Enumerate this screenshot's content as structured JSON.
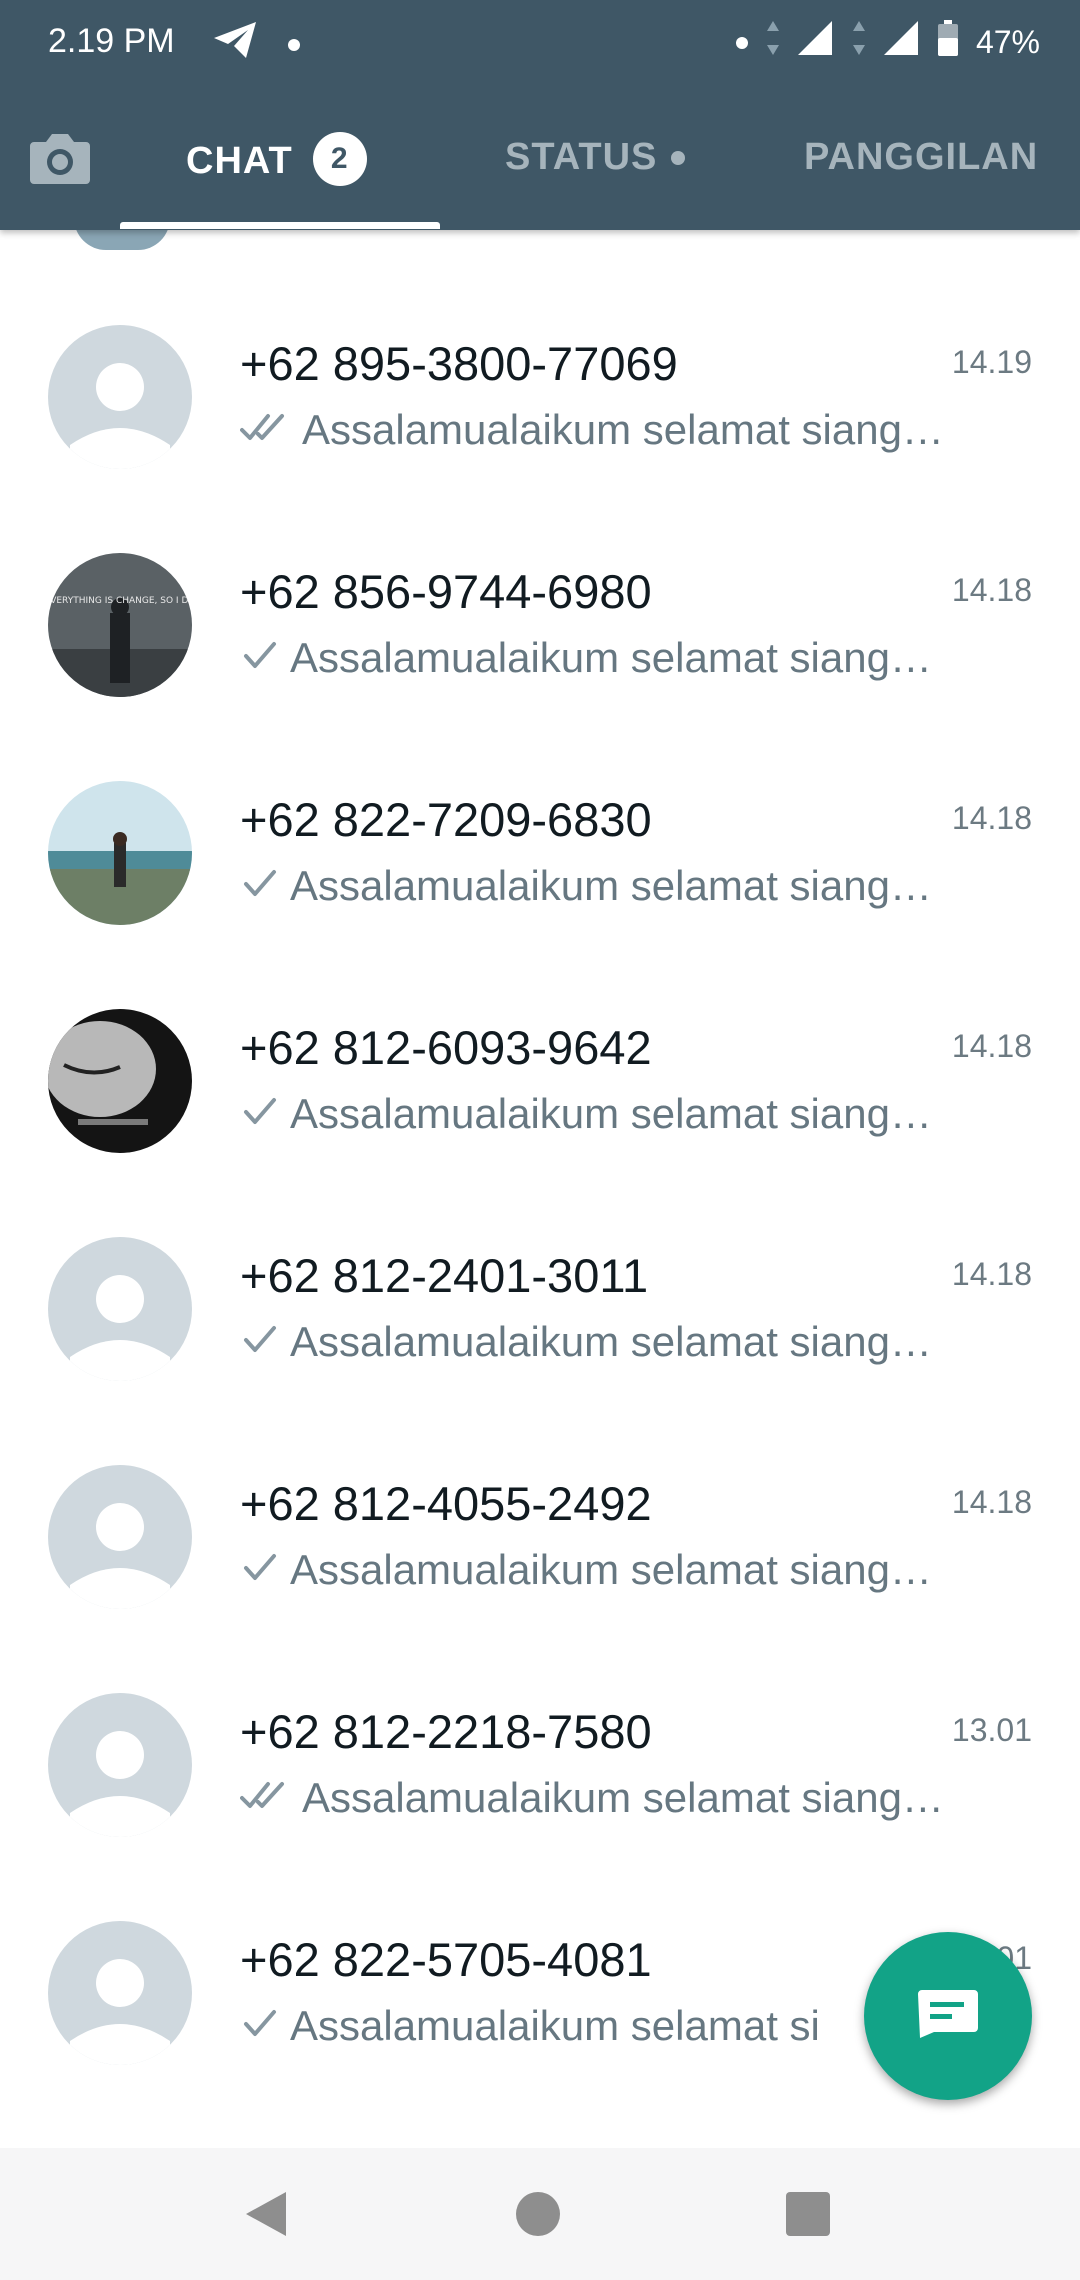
{
  "status_bar": {
    "time": "2.19 PM",
    "battery": "47%",
    "icons": [
      "telegram-icon",
      "dot-icon",
      "dot-icon",
      "data-arrows-icon",
      "signal-icon",
      "signal-icon",
      "battery-icon"
    ]
  },
  "tabs": {
    "camera_icon": "camera-icon",
    "chat": {
      "label": "CHAT",
      "badge": "2"
    },
    "status": {
      "label": "STATUS"
    },
    "calls": {
      "label": "PANGGILAN"
    },
    "active": "chat"
  },
  "chats": [
    {
      "name": "+62 895-3800-77069",
      "time": "14.19",
      "preview": "Assalamualaikum selamat siang…",
      "tick": "double",
      "avatar": "default"
    },
    {
      "name": "+62 856-9744-6980",
      "time": "14.18",
      "preview": "Assalamualaikum selamat siang…",
      "tick": "single",
      "avatar": "photo-dark",
      "avatar_text": "EVERYTHING IS CHANGE, SO I DO"
    },
    {
      "name": "+62 822-7209-6830",
      "time": "14.18",
      "preview": "Assalamualaikum selamat siang…",
      "tick": "single",
      "avatar": "photo-landscape"
    },
    {
      "name": "+62 812-6093-9642",
      "time": "14.18",
      "preview": "Assalamualaikum selamat siang…",
      "tick": "single",
      "avatar": "photo-bw"
    },
    {
      "name": "+62 812-2401-3011",
      "time": "14.18",
      "preview": "Assalamualaikum selamat siang…",
      "tick": "single",
      "avatar": "default"
    },
    {
      "name": "+62 812-4055-2492",
      "time": "14.18",
      "preview": "Assalamualaikum selamat siang…",
      "tick": "single",
      "avatar": "default"
    },
    {
      "name": "+62 812-2218-7580",
      "time": "13.01",
      "preview": "Assalamualaikum selamat siang…",
      "tick": "double",
      "avatar": "default"
    },
    {
      "name": "+62 822-5705-4081",
      "time": "13.01",
      "preview": "Assalamualaikum selamat si",
      "tick": "single",
      "avatar": "default"
    }
  ],
  "fab": {
    "icon": "new-chat-message-icon"
  },
  "colors": {
    "header": "#3f5766",
    "accent": "#12a387",
    "tick": "#8696a0",
    "default_avatar": "#cfd8de"
  },
  "nav": {
    "icons": [
      "back-icon",
      "home-icon",
      "recents-icon"
    ]
  }
}
